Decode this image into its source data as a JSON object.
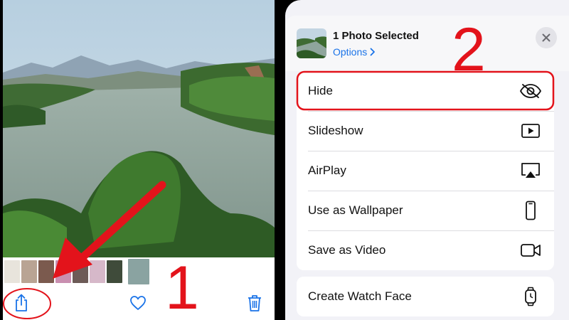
{
  "colors": {
    "accent_blue": "#1a73e8",
    "annotation_red": "#e3131b",
    "sheet_background": "#f2f2f7"
  },
  "photos_app": {
    "toolbar": {
      "share_icon": "share-icon",
      "favorite_icon": "heart-icon",
      "delete_icon": "trash-icon"
    }
  },
  "share_sheet": {
    "header": {
      "title": "1 Photo Selected",
      "options_label": "Options",
      "options_icon": "chevron-right-icon",
      "close_icon": "close-icon"
    },
    "actions": [
      {
        "label": "Hide",
        "icon": "eye-slash-icon"
      },
      {
        "label": "Slideshow",
        "icon": "play-icon"
      },
      {
        "label": "AirPlay",
        "icon": "airplay-icon"
      },
      {
        "label": "Use as Wallpaper",
        "icon": "phone-icon"
      },
      {
        "label": "Save as Video",
        "icon": "video-camera-icon"
      }
    ],
    "actions_2": [
      {
        "label": "Create Watch Face",
        "icon": "watch-icon"
      }
    ]
  },
  "annotations": {
    "step_1": "1",
    "step_2": "2"
  }
}
